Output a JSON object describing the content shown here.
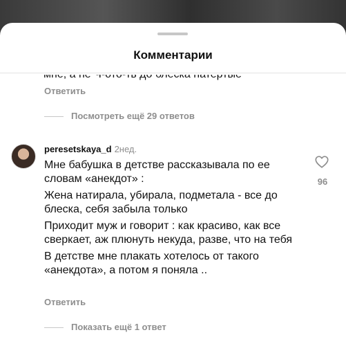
{
  "sheet": {
    "title": "Комментарии"
  },
  "previous_comment": {
    "cut_text": "мне, а не Ч-ото-ть до блеска натертые",
    "reply_label": "Ответить",
    "more_replies_label": "Посмотреть ещё 29 ответов"
  },
  "comment": {
    "username": "peresetskaya_d",
    "time": "2нед.",
    "paragraphs": [
      "Мне бабушка в детстве рассказывала по ее словам «анекдот» :",
      "Жена натирала, убирала, подметала - все до блеска, себя забыла только",
      "Приходит муж и говорит : как красиво, как все сверкает, аж плюнуть некуда, разве, что на тебя",
      "В детстве мне плакать хотелось от такого «анекдота», а потом я поняла .."
    ],
    "like_count": "96",
    "reply_label": "Ответить",
    "more_replies_label": "Показать ещё 1 ответ"
  },
  "icons": {
    "like": "heart-outline-icon",
    "avatar": "user-avatar"
  },
  "colors": {
    "secondary_text": "#8e8e8e",
    "primary_text": "#111111",
    "sheet_bg": "#ffffff"
  }
}
